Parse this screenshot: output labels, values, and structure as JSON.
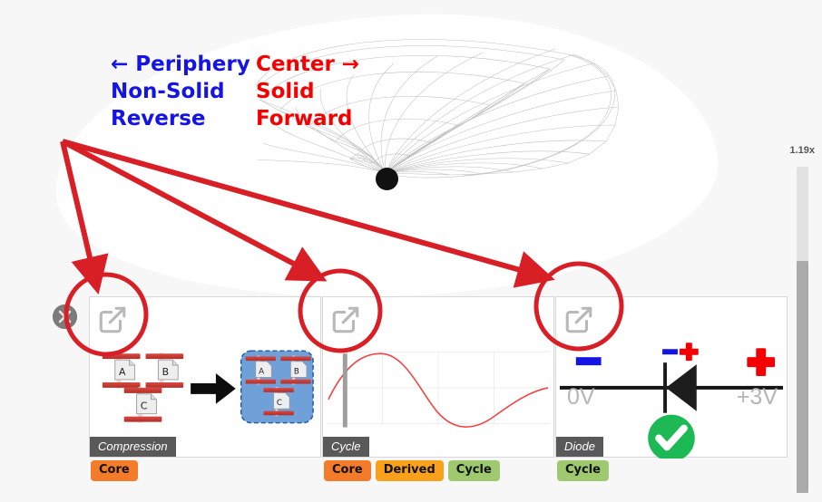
{
  "annotations": {
    "left": {
      "color": "#1414e6",
      "lines": [
        "← Periphery",
        "Non-Solid",
        "Reverse"
      ]
    },
    "right": {
      "color": "#f40000",
      "lines": [
        "Center →",
        "Solid",
        "Forward"
      ]
    }
  },
  "viewport": {
    "zoom_level": "1.19x",
    "close_button_icon": "close-circle-icon",
    "mesh_label": "wireframe-surface",
    "apex_marker": "origin-dot"
  },
  "cards": [
    {
      "id": "compression",
      "caption": "Compression",
      "open_icon": "external-link-icon",
      "tags": [
        {
          "label": "Core",
          "color": "#f47b29",
          "class": "tag-core"
        }
      ],
      "art": {
        "type": "compression-diagram",
        "documents": [
          "A",
          "B",
          "C"
        ],
        "arrow": "right-arrow",
        "group_label": "compressed-group"
      }
    },
    {
      "id": "cycle",
      "caption": "Cycle",
      "open_icon": "external-link-icon",
      "tags": [
        {
          "label": "Core",
          "color": "#f47b29",
          "class": "tag-core"
        },
        {
          "label": "Derived",
          "color": "#f9a11b",
          "class": "tag-derived"
        },
        {
          "label": "Cycle",
          "color": "#9ec96e",
          "class": "tag-cycle"
        }
      ],
      "art": {
        "type": "sine-wave",
        "curve_color": "#ef4444",
        "cursor": "playhead-cursor",
        "gridlines": 4
      }
    },
    {
      "id": "diode",
      "caption": "Diode",
      "open_icon": "external-link-icon",
      "tags": [
        {
          "label": "Cycle",
          "color": "#9ec96e",
          "class": "tag-cycle"
        }
      ],
      "art": {
        "type": "diode-circuit",
        "left_voltage": "0V",
        "right_voltage": "+3V",
        "left_sign": "−",
        "right_sign": "+",
        "mid_minus": "−",
        "mid_plus": "+",
        "status_icon": "check-circle-icon",
        "status_color": "#1db954"
      }
    }
  ],
  "markup": {
    "arrow_count": 3,
    "highlight_circle_count": 3,
    "highlight_color": "#d81f26"
  }
}
